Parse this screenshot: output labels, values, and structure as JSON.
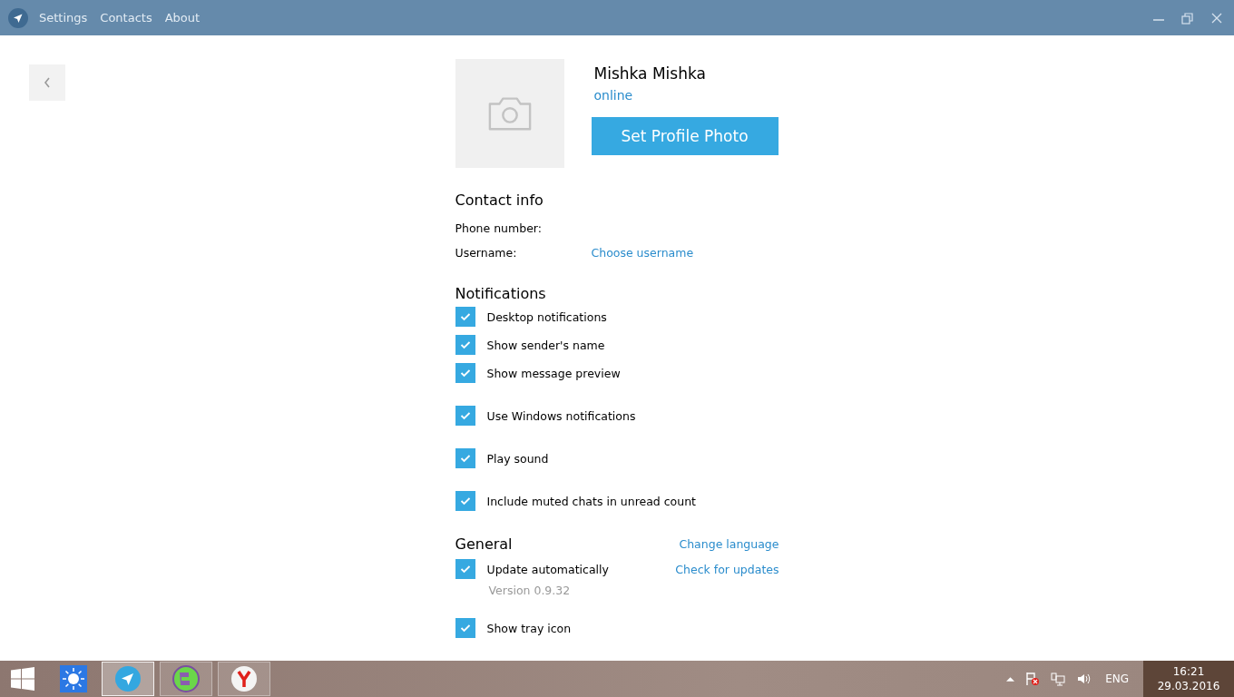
{
  "window": {
    "menu": [
      "Settings",
      "Contacts",
      "About"
    ]
  },
  "profile": {
    "name": "Mishka Mishka",
    "status": "online",
    "photo_button": "Set Profile Photo"
  },
  "contact_info": {
    "title": "Contact info",
    "rows": [
      {
        "label": "Phone number:"
      },
      {
        "label": "Username:",
        "link": "Choose username"
      }
    ]
  },
  "notifications": {
    "title": "Notifications",
    "items": [
      {
        "label": "Desktop notifications",
        "checked": true
      },
      {
        "label": "Show sender's name",
        "checked": true
      },
      {
        "label": "Show message preview",
        "checked": true
      },
      {
        "label": "Use Windows notifications",
        "checked": true
      },
      {
        "label": "Play sound",
        "checked": true
      },
      {
        "label": "Include muted chats in unread count",
        "checked": true
      }
    ]
  },
  "general": {
    "title": "General",
    "link": "Change language",
    "items": [
      {
        "label": "Update automatically",
        "checked": true,
        "link": "Check for updates",
        "note": "Version 0.9.32"
      },
      {
        "label": "Show tray icon",
        "checked": true
      }
    ]
  },
  "taskbar": {
    "apps": [
      {
        "kind": "telegram",
        "selected": true
      },
      {
        "kind": "globe",
        "selected": false
      },
      {
        "kind": "yandex",
        "selected": false
      }
    ],
    "language": "ENG",
    "time": "16:21",
    "date": "29.03.2016"
  }
}
